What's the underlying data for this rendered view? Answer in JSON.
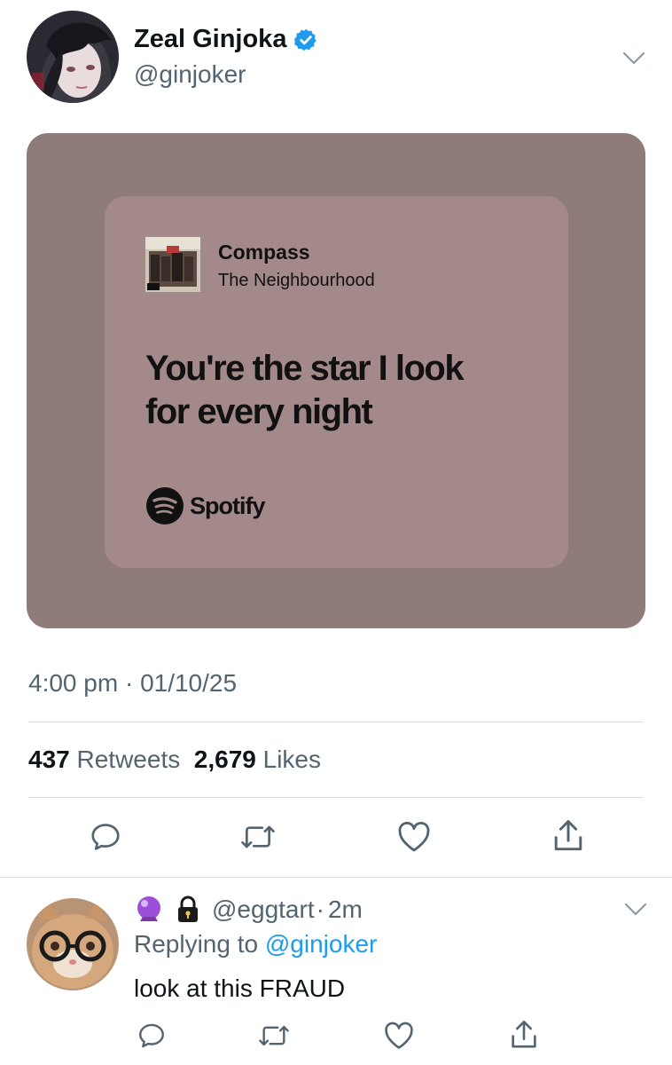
{
  "tweet": {
    "author_name": "Zeal Ginjoka",
    "author_handle": "@ginjoker",
    "verified": true,
    "media": {
      "song_title": "Compass",
      "artist": "The Neighbourhood",
      "lyric_line1": "You're the star I look",
      "lyric_line2": "for every night",
      "brand": "Spotify"
    },
    "time": "4:00 pm",
    "date": "01/10/25",
    "retweets_count": "437",
    "retweets_label": "Retweets",
    "likes_count": "2,679",
    "likes_label": "Likes"
  },
  "reply": {
    "handle": "@eggtart",
    "time_ago": "2m",
    "replying_prefix": "Replying to",
    "replying_to": "@ginjoker",
    "text": "look at this FRAUD"
  },
  "colors": {
    "accent": "#1d9bf0",
    "muted": "#536471",
    "card_outer": "#907b7b",
    "card_inner": "#a4898b"
  },
  "icons": [
    "verified-badge-icon",
    "chevron-down-icon",
    "reply-icon",
    "retweet-icon",
    "like-icon",
    "share-icon",
    "crystal-ball-icon",
    "lock-icon",
    "spotify-icon"
  ]
}
